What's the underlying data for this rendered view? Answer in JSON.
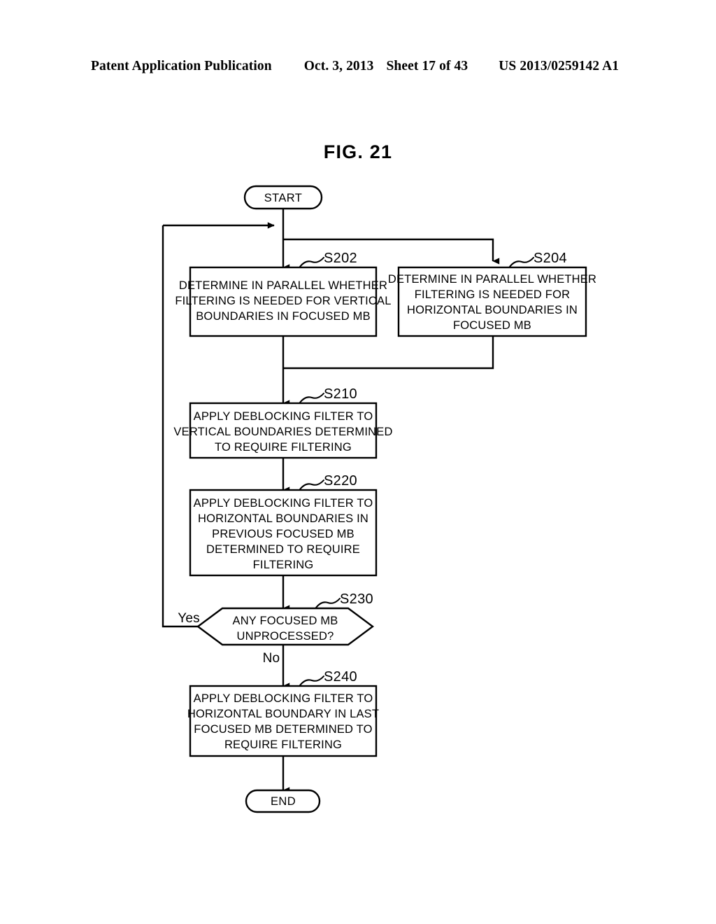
{
  "header": {
    "publication": "Patent Application Publication",
    "date": "Oct. 3, 2013",
    "sheet": "Sheet 17 of 43",
    "patent_number": "US 2013/0259142 A1"
  },
  "figure": {
    "title": "FIG. 21"
  },
  "flowchart": {
    "start_label": "START",
    "end_label": "END",
    "branch_yes": "Yes",
    "branch_no": "No",
    "steps": [
      {
        "id": "S202",
        "ref": "S202",
        "lines": [
          "DETERMINE IN PARALLEL WHETHER",
          "FILTERING IS NEEDED FOR VERTICAL",
          "BOUNDARIES IN FOCUSED MB"
        ]
      },
      {
        "id": "S204",
        "ref": "S204",
        "lines": [
          "DETERMINE IN PARALLEL WHETHER",
          "FILTERING IS NEEDED FOR",
          "HORIZONTAL BOUNDARIES IN",
          "FOCUSED MB"
        ]
      },
      {
        "id": "S210",
        "ref": "S210",
        "lines": [
          "APPLY DEBLOCKING FILTER TO",
          "VERTICAL BOUNDARIES DETERMINED",
          "TO REQUIRE FILTERING"
        ]
      },
      {
        "id": "S220",
        "ref": "S220",
        "lines": [
          "APPLY DEBLOCKING FILTER TO",
          "HORIZONTAL BOUNDARIES IN",
          "PREVIOUS FOCUSED MB",
          "DETERMINED TO REQUIRE",
          "FILTERING"
        ]
      },
      {
        "id": "S230",
        "ref": "S230",
        "lines": [
          "ANY FOCUSED MB",
          "UNPROCESSED?"
        ]
      },
      {
        "id": "S240",
        "ref": "S240",
        "lines": [
          "APPLY DEBLOCKING FILTER TO",
          "HORIZONTAL BOUNDARY IN LAST",
          "FOCUSED MB DETERMINED TO",
          "REQUIRE FILTERING"
        ]
      }
    ]
  }
}
